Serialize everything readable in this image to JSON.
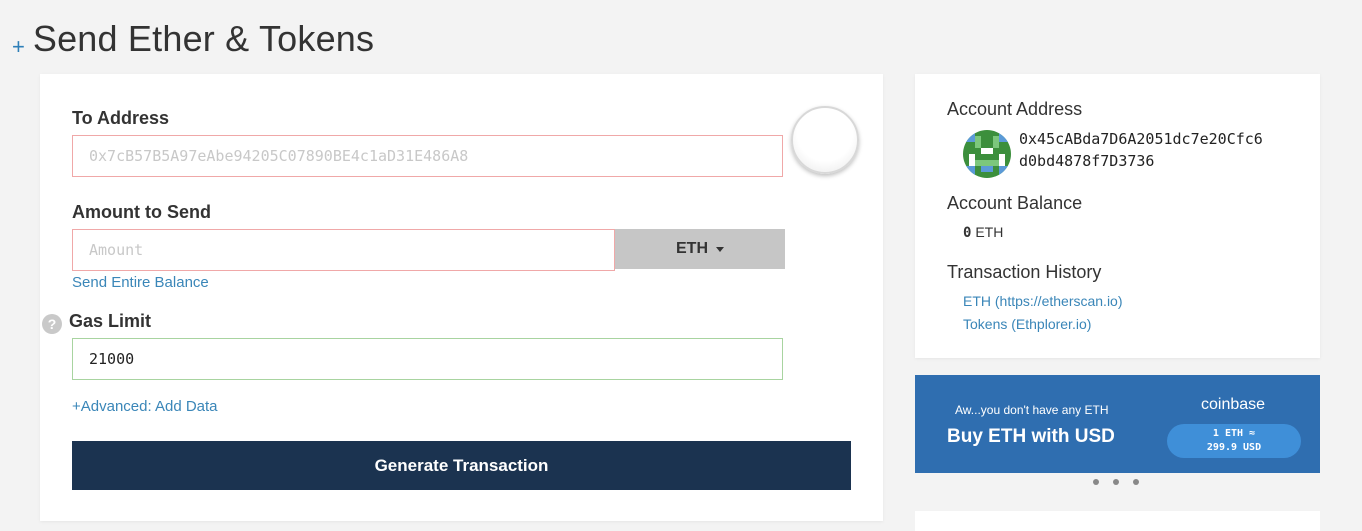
{
  "header": {
    "plus_icon": "+",
    "title": "Send Ether & Tokens"
  },
  "form": {
    "to_address": {
      "label": "To Address",
      "placeholder": "0x7cB57B5A97eAbe94205C07890BE4c1aD31E486A8"
    },
    "amount": {
      "label": "Amount to Send",
      "placeholder": "Amount",
      "currency": "ETH",
      "send_entire_balance": "Send Entire Balance"
    },
    "gas_limit": {
      "label": "Gas Limit",
      "value": "21000",
      "help_icon": "?"
    },
    "advanced_link": "+Advanced: Add Data",
    "generate_button": "Generate Transaction"
  },
  "sidebar": {
    "account_address_label": "Account Address",
    "address_line1": "0x45cABda7D6A2051dc7e20Cfc6",
    "address_line2": "d0bd4878f7D3736",
    "account_balance_label": "Account Balance",
    "balance_value": "0",
    "balance_unit": "ETH",
    "tx_history_label": "Transaction History",
    "links": [
      "ETH (https://etherscan.io)",
      "Tokens (Ethplorer.io)"
    ]
  },
  "coinbase": {
    "small_text": "Aw...you don't have any ETH",
    "big_text": "Buy ETH with USD",
    "logo": "coinbase",
    "rate_line1": "1 ETH ≈",
    "rate_line2": "299.9 USD"
  },
  "colors": {
    "accent": "#3a86b8",
    "button": "#1b3350",
    "coinbase": "#2f6eb0"
  }
}
